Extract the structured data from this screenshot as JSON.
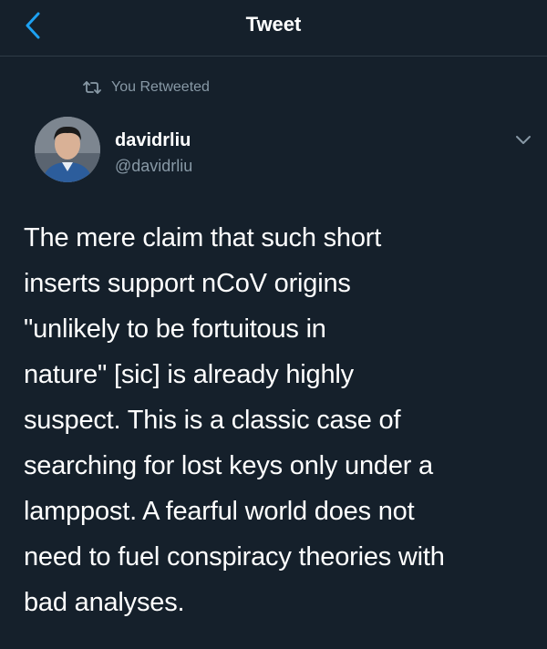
{
  "header": {
    "title": "Tweet"
  },
  "retweet": {
    "label": "You Retweeted"
  },
  "author": {
    "name": "davidrliu",
    "handle": "@davidrliu"
  },
  "tweet": {
    "lines": [
      "The mere claim that such short",
      "inserts support nCoV origins",
      "\"unlikely to be fortuitous in",
      "nature\" [sic] is already highly",
      "suspect. This is a classic case of",
      "searching for lost keys only under a",
      "lamppost. A fearful world does not",
      "need to fuel conspiracy theories with",
      "bad analyses."
    ]
  },
  "icons": {
    "back": "chevron-left-icon",
    "retweet": "retweet-icon",
    "menu": "chevron-down-icon"
  },
  "colors": {
    "background": "#15202b",
    "accent": "#1da1f2",
    "secondary_text": "#8899a6"
  }
}
